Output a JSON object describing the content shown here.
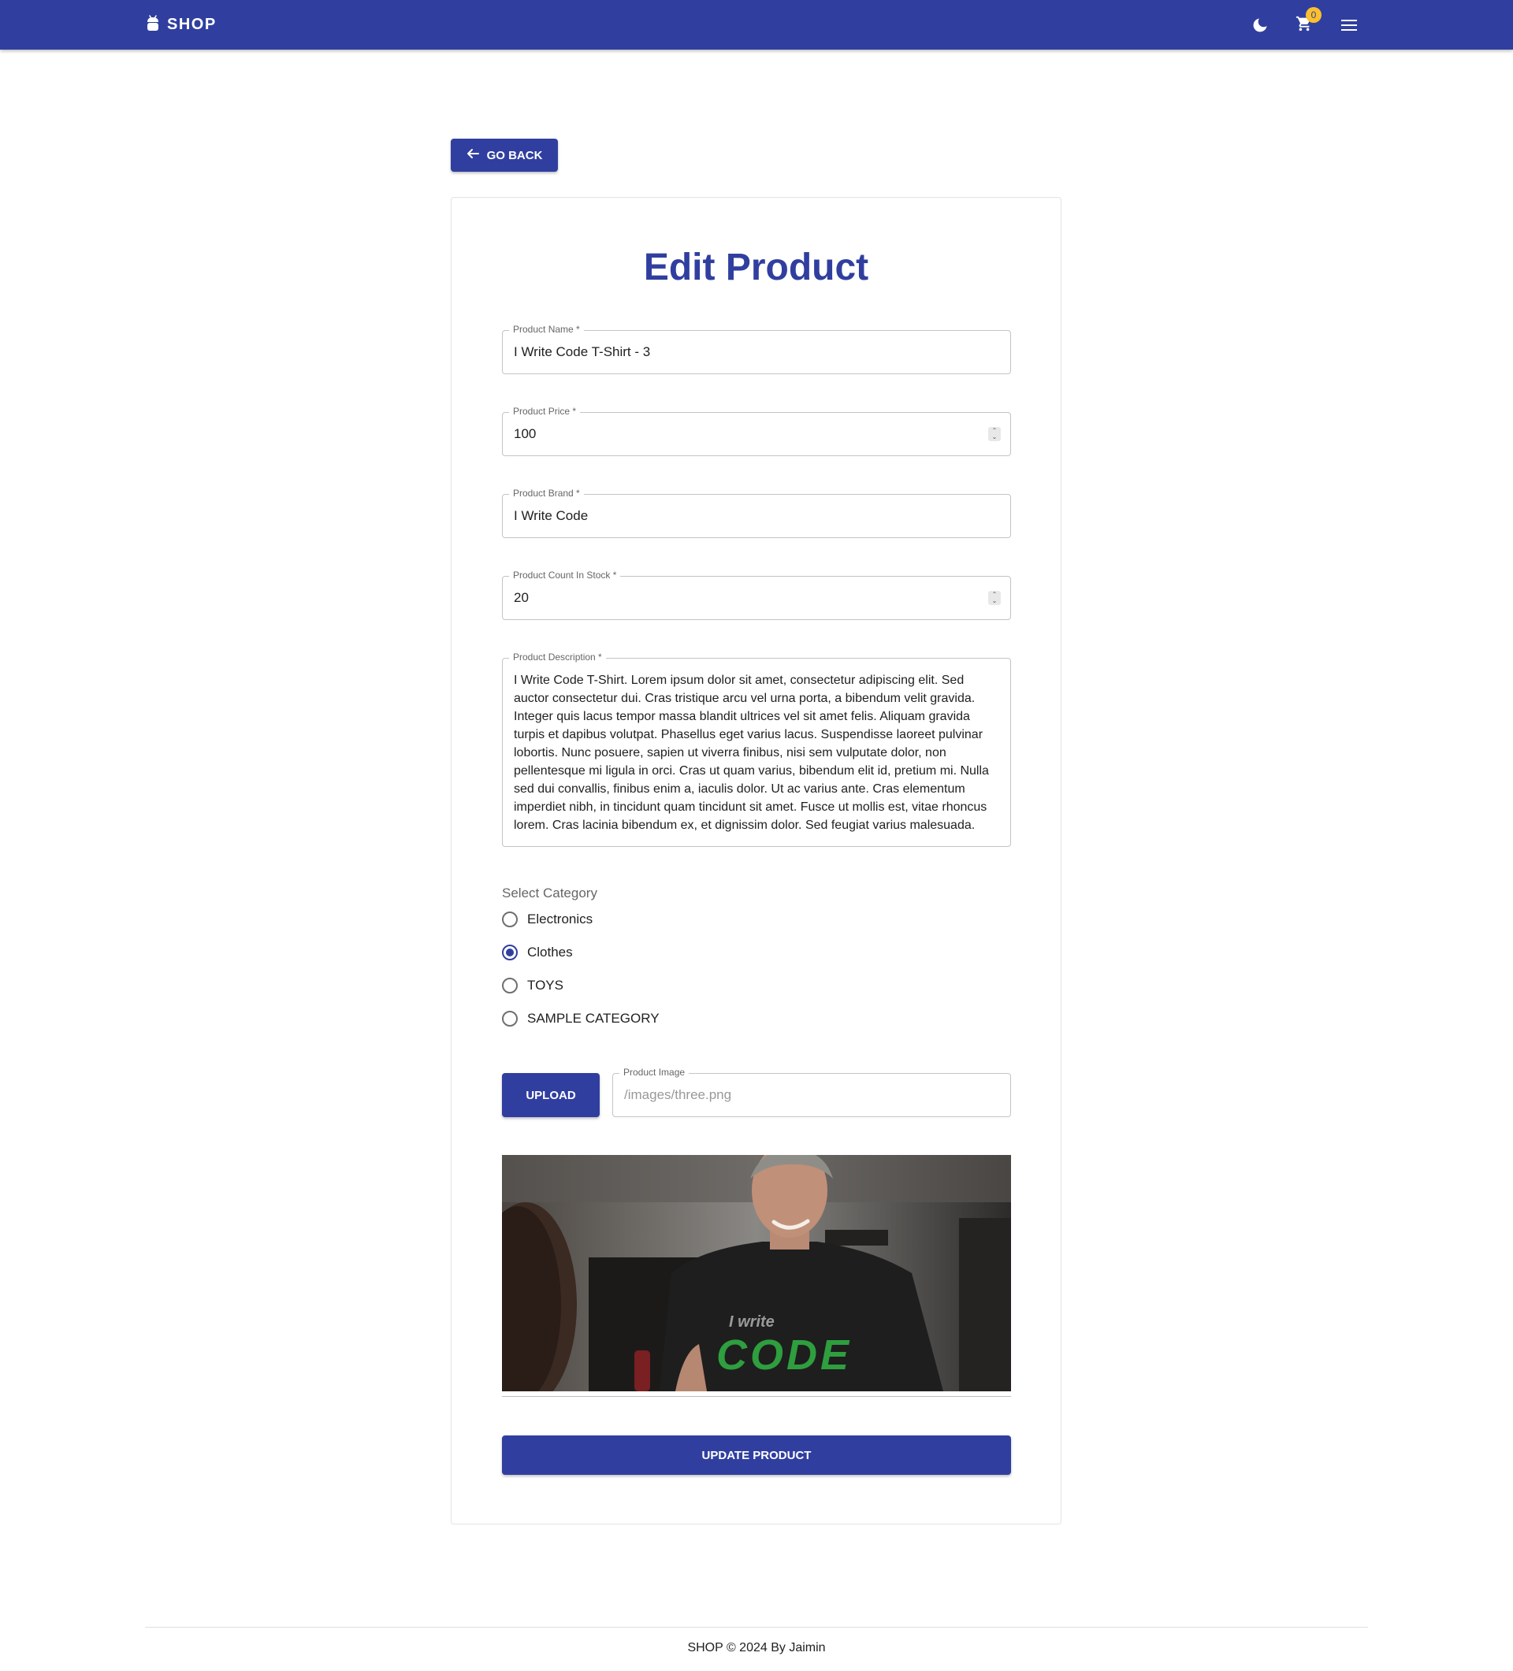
{
  "app": {
    "title": "SHOP",
    "logo_icon": "android-icon",
    "theme_icon": "moon-icon",
    "cart_icon": "cart-icon",
    "cart_count": "0",
    "menu_icon": "hamburger-menu-icon"
  },
  "nav": {
    "back_label": "GO BACK",
    "back_icon": "arrow-left-icon"
  },
  "form": {
    "title": "Edit Product",
    "fields": {
      "name": {
        "label": "Product Name *",
        "value": "I Write Code T-Shirt - 3"
      },
      "price": {
        "label": "Product Price *",
        "value": "100"
      },
      "brand": {
        "label": "Product Brand *",
        "value": "I Write Code"
      },
      "stock": {
        "label": "Product Count In Stock *",
        "value": "20"
      },
      "description": {
        "label": "Product Description *",
        "value": "I Write Code T-Shirt. Lorem ipsum dolor sit amet, consectetur adipiscing elit. Sed auctor consectetur dui. Cras tristique arcu vel urna porta, a bibendum velit gravida. Integer quis lacus tempor massa blandit ultrices vel sit amet felis. Aliquam gravida turpis et dapibus volutpat. Phasellus eget varius lacus. Suspendisse laoreet pulvinar lobortis. Nunc posuere, sapien ut viverra finibus, nisi sem vulputate dolor, non pellentesque mi ligula in orci. Cras ut quam varius, bibendum elit id, pretium mi. Nulla sed dui convallis, finibus enim a, iaculis dolor. Ut ac varius ante. Cras elementum imperdiet nibh, in tincidunt quam tincidunt sit amet. Fusce ut mollis est, vitae rhoncus lorem. Cras lacinia bibendum ex, et dignissim dolor. Sed feugiat varius malesuada."
      }
    },
    "category": {
      "label": "Select Category",
      "options": [
        "Electronics",
        "Clothes",
        "TOYS",
        "SAMPLE CATEGORY"
      ],
      "selected": "Clothes"
    },
    "image": {
      "upload_label": "UPLOAD",
      "field_label": "Product Image",
      "value": "/images/three.png",
      "shirt_text_line1": "I write",
      "shirt_text_line2": "CODE"
    },
    "submit_label": "UPDATE PRODUCT"
  },
  "footer": {
    "text": "SHOP © 2024 By Jaimin"
  },
  "colors": {
    "primary": "#303f9f",
    "badge": "#fbc02d",
    "shirt_print": "#2e9e3e"
  }
}
